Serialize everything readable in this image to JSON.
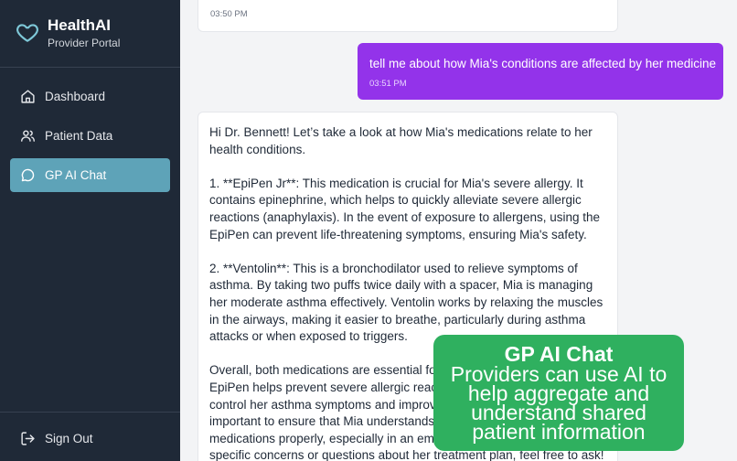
{
  "brand": {
    "title": "HealthAI",
    "subtitle": "Provider Portal"
  },
  "nav": {
    "items": [
      {
        "label": "Dashboard",
        "icon": "home-icon",
        "active": false
      },
      {
        "label": "Patient Data",
        "icon": "users-icon",
        "active": false
      },
      {
        "label": "GP AI Chat",
        "icon": "chat-bubble-icon",
        "active": true
      }
    ],
    "signout": "Sign Out"
  },
  "chat": {
    "prev_ai_time": "03:50 PM",
    "user_message": {
      "text": "tell me about how Mia's conditions are affected by her medicine",
      "time": "03:51 PM"
    },
    "ai_response": {
      "paragraphs": [
        "Hi Dr. Bennett! Let’s take a look at how Mia's medications relate to her health conditions.",
        "1. **EpiPen Jr**: This medication is crucial for Mia's severe allergy. It contains epinephrine, which helps to quickly alleviate severe allergic reactions (anaphylaxis). In the event of exposure to allergens, using the EpiPen can prevent life-threatening symptoms, ensuring Mia's safety.",
        "2. **Ventolin**: This is a bronchodilator used to relieve symptoms of asthma. By taking two puffs twice daily with a spacer, Mia is managing her moderate asthma effectively. Ventolin works by relaxing the muscles in the airways, making it easier to breathe, particularly during asthma attacks or when exposed to triggers.",
        "Overall, both medications are essential for managing Mia's health. The EpiPen helps prevent severe allergic reactions, while Ventolin helps control her asthma symptoms and improve her quality of life. It's important to ensure that Mia understands how and when to use these medications properly, especially in an emergency. If you have any specific concerns or questions about her treatment plan, feel free to ask!"
      ]
    }
  },
  "promo": {
    "title": "GP AI Chat",
    "body": "Providers can use AI to help aggregate and understand shared patient information"
  },
  "colors": {
    "sidebar_bg": "#1f2937",
    "active_nav": "#5ea3b8",
    "user_bubble": "#9333ea",
    "promo_bg": "#2fb05f",
    "brand_icon": "#7ec8d8"
  }
}
